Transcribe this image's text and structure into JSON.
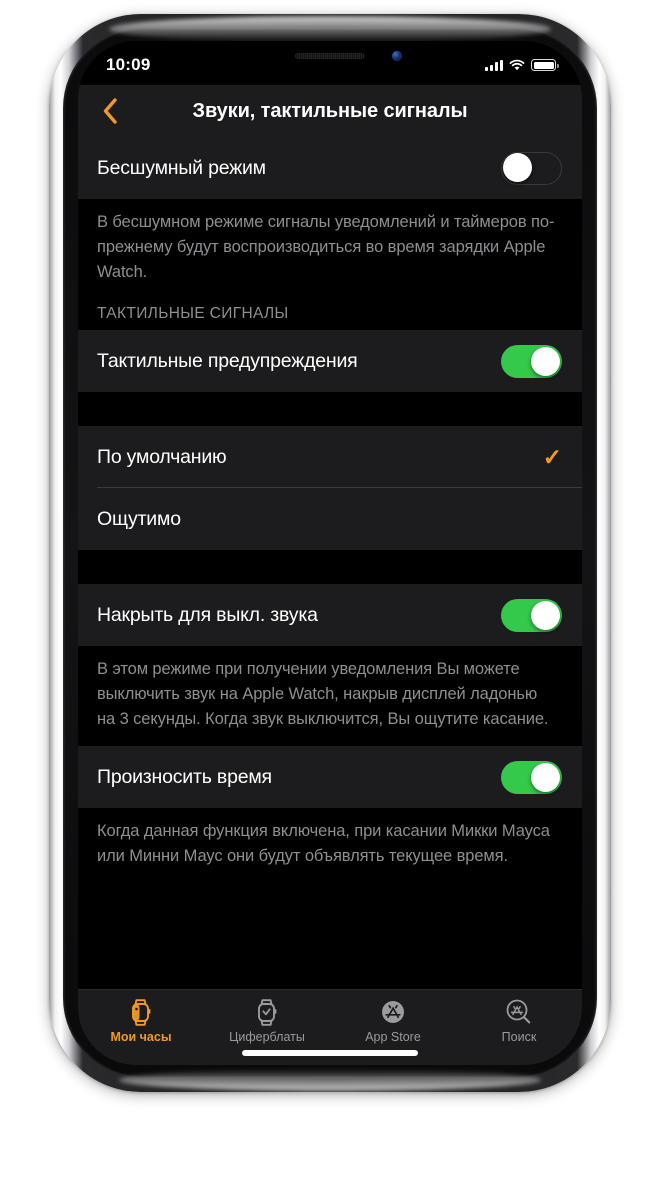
{
  "status_bar": {
    "time": "10:09",
    "signal_icon": "cellular-bars-icon",
    "wifi_icon": "wifi-icon",
    "battery_icon": "battery-full-icon"
  },
  "nav": {
    "back_icon": "chevron-left-icon",
    "title": "Звуки, тактильные сигналы"
  },
  "colors": {
    "accent": "#F09A25",
    "toggle_on": "#34C94B",
    "row_bg": "#1C1C1E",
    "page_bg": "#000000",
    "secondary_text": "#8E8E93",
    "separator": "#3A3A3C"
  },
  "settings": {
    "silent_mode": {
      "label": "Бесшумный режим",
      "value": "off",
      "footnote": "В бесшумном режиме сигналы уведомлений и таймеров по-прежнему будут воспроизводиться во время зарядки Apple Watch."
    },
    "haptics_section_header": "ТАКТИЛЬНЫЕ СИГНАЛЫ",
    "haptic_alerts": {
      "label": "Тактильные предупреждения",
      "value": "on"
    },
    "haptic_strength_options": [
      {
        "label": "По умолчанию",
        "selected": true,
        "check_icon": "checkmark-icon"
      },
      {
        "label": "Ощутимо",
        "selected": false,
        "check_icon": ""
      }
    ],
    "cover_to_mute": {
      "label": "Накрыть для выкл. звука",
      "value": "on",
      "footnote": "В этом режиме при получении уведомления Вы можете выключить звук на Apple Watch, накрыв дисплей ладонью на 3 секунды. Когда звук выключится, Вы ощутите касание."
    },
    "speak_time": {
      "label": "Произносить время",
      "value": "on",
      "footnote": "Когда данная функция включена, при касании Микки Мауса или Минни Маус они будут объявлять текущее время."
    }
  },
  "tab_bar": {
    "items": [
      {
        "label": "Мои часы",
        "icon": "watch-icon",
        "active": true
      },
      {
        "label": "Циферблаты",
        "icon": "watch-face-icon",
        "active": false
      },
      {
        "label": "App Store",
        "icon": "app-store-icon",
        "active": false
      },
      {
        "label": "Поиск",
        "icon": "app-store-search-icon",
        "active": false
      }
    ]
  }
}
